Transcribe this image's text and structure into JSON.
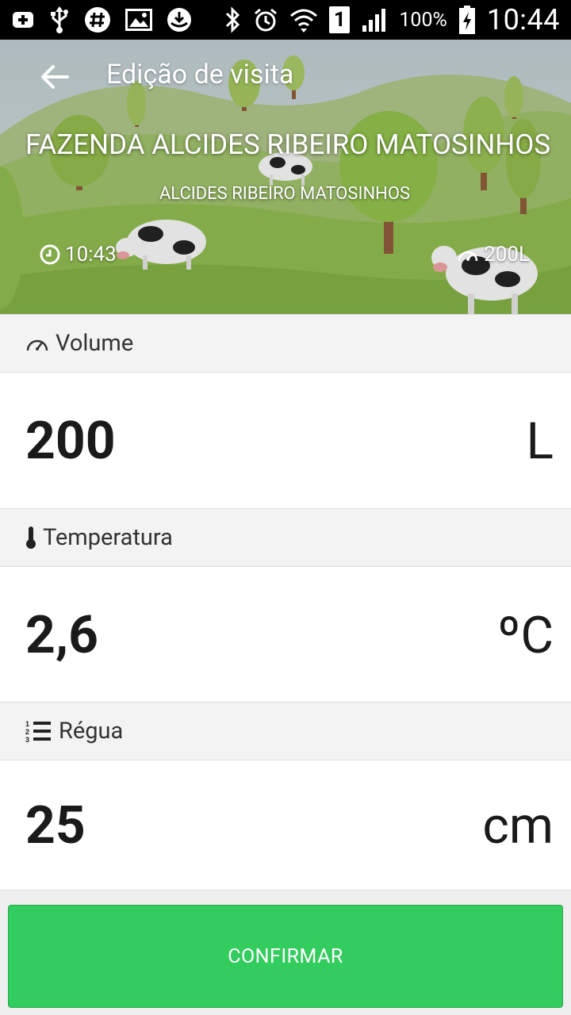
{
  "status_bar": {
    "battery_pct": "100%",
    "time": "10:44",
    "notification_count": "1"
  },
  "header": {
    "title": "Edição de visita",
    "farm_name": "FAZENDA ALCIDES RIBEIRO MATOSINHOS",
    "producer_name": "ALCIDES RIBEIRO MATOSINHOS",
    "visit_time": "10:43",
    "visit_volume": "200L"
  },
  "fields": {
    "volume": {
      "label": "Volume",
      "value": "200",
      "unit": "L",
      "icon": "gauge-icon"
    },
    "temperature": {
      "label": "Temperatura",
      "value": "2,6",
      "unit": "ºC",
      "icon": "thermometer-icon"
    },
    "ruler": {
      "label": "Régua",
      "value": "25",
      "unit": "cm",
      "icon": "numbered-list-icon"
    }
  },
  "actions": {
    "confirm_label": "CONFIRMAR"
  },
  "colors": {
    "status_bar": "#000000",
    "confirm_button": "#33cc5e",
    "section_label_bg": "#f3f3f3",
    "sky": "#c4cfd2",
    "grass": "#8dbb4a"
  }
}
